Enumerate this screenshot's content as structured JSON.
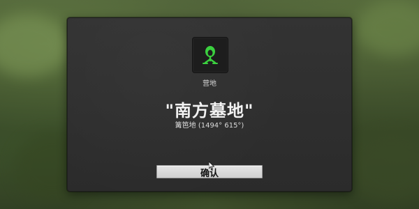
{
  "dialog": {
    "icon_name": "graveyard-icon",
    "icon_label": "营地",
    "title": "\"南方墓地\"",
    "subtitle": "篝笆地 (1494° 615°)",
    "confirm_label": "确认"
  },
  "colors": {
    "icon_accent": "#35d33a",
    "dialog_bg": "#2f2f2f",
    "button_bg": "#dcdcdc"
  }
}
